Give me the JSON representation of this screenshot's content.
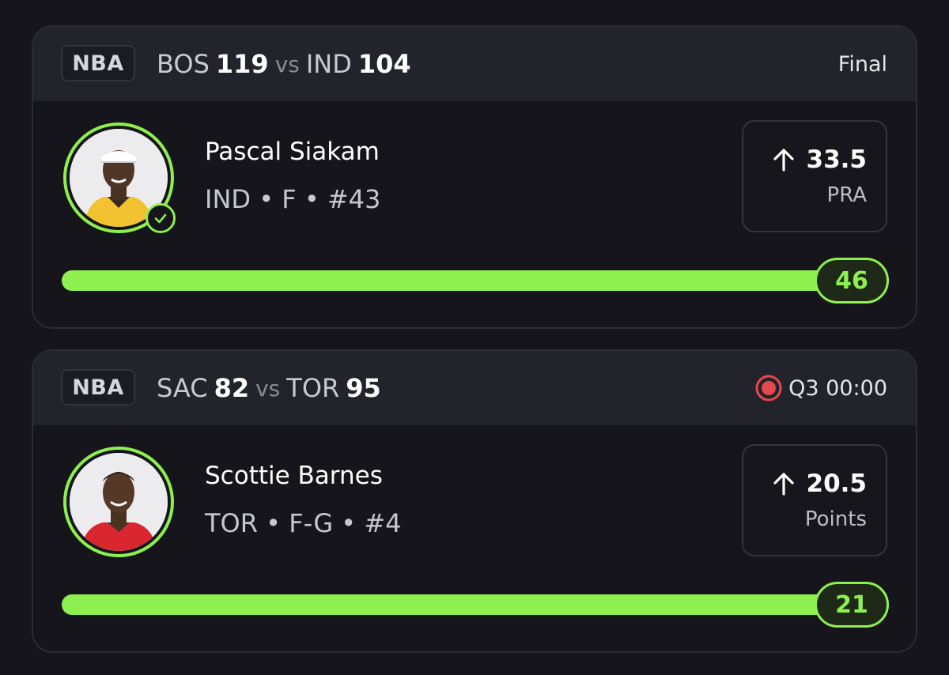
{
  "cards": [
    {
      "league": "NBA",
      "home_team": "BOS",
      "home_score": "119",
      "vs": "vs",
      "away_team": "IND",
      "away_score": "104",
      "status": "Final",
      "player_name": "Pascal Siakam",
      "player_meta": "IND • F • #43",
      "direction_icon": "arrow-up-icon",
      "line": "33.5",
      "stat": "PRA",
      "result": "46",
      "progress": 1.0,
      "verified_icon": "check-circle-icon",
      "jersey_color": "#f2c230"
    },
    {
      "league": "NBA",
      "home_team": "SAC",
      "home_score": "82",
      "vs": "vs",
      "away_team": "TOR",
      "away_score": "95",
      "status_icon": "live-record-icon",
      "status": "Q3 00:00",
      "player_name": "Scottie Barnes",
      "player_meta": "TOR • F-G • #4",
      "direction_icon": "arrow-up-icon",
      "line": "20.5",
      "stat": "Points",
      "result": "21",
      "progress": 1.0,
      "jersey_color": "#d9262f"
    }
  ],
  "colors": {
    "accent": "#8ef04f",
    "live": "#e5484d",
    "background": "#15151b",
    "header": "#23232b"
  }
}
